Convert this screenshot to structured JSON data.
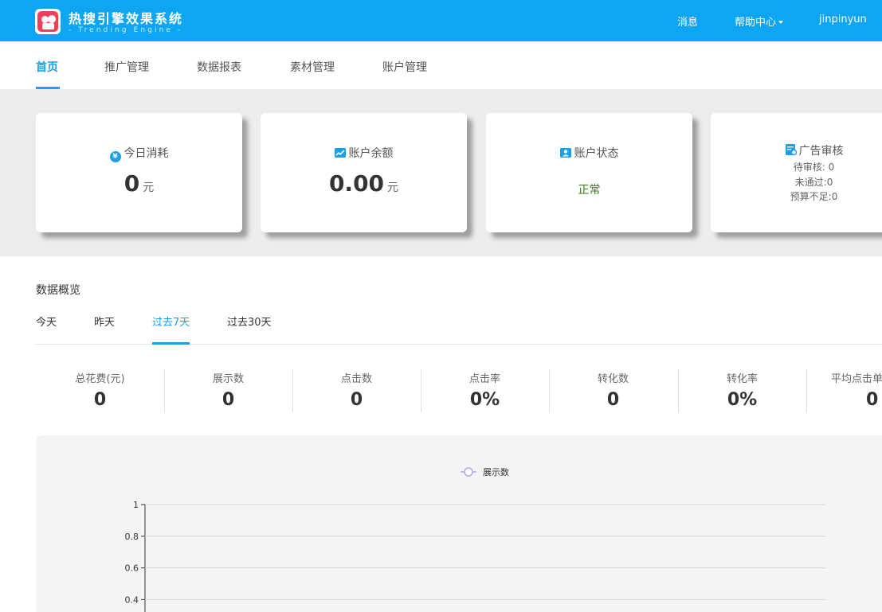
{
  "header": {
    "title": "热搜引擎效果系统",
    "subtitle": "- Trending Engine -",
    "nav": {
      "messages": "消息",
      "help": "帮助中心",
      "user": "jinpinyun"
    },
    "color": "#0ea5f2"
  },
  "topnav": {
    "items": [
      "首页",
      "推广管理",
      "数据报表",
      "素材管理",
      "账户管理"
    ],
    "active_index": 0
  },
  "cards": {
    "today_cost": {
      "title": "今日消耗",
      "value": "0",
      "unit": "元",
      "icon": "yen-icon"
    },
    "balance": {
      "title": "账户余额",
      "value": "0.00",
      "unit": "元",
      "icon": "trend-icon"
    },
    "status": {
      "title": "账户状态",
      "value": "正常",
      "icon": "user-card-icon",
      "value_color": "#2f7d12"
    },
    "review": {
      "title": "广告审核",
      "icon": "review-doc-icon",
      "pending": "待审核: 0",
      "rejected": "未通过:0",
      "budget": "预算不足:0"
    }
  },
  "overview": {
    "title": "数据概览",
    "tabs": [
      "今天",
      "昨天",
      "过去7天",
      "过去30天"
    ],
    "active_tab": 2,
    "metrics": [
      {
        "label": "总花费(元)",
        "value": "0"
      },
      {
        "label": "展示数",
        "value": "0"
      },
      {
        "label": "点击数",
        "value": "0"
      },
      {
        "label": "点击率",
        "value": "0%"
      },
      {
        "label": "转化数",
        "value": "0"
      },
      {
        "label": "转化率",
        "value": "0%"
      },
      {
        "label": "平均点击单",
        "value": "0"
      }
    ]
  },
  "chart_data": {
    "type": "line",
    "legend": [
      "展示数"
    ],
    "legend_placement": "top-center",
    "series": [
      {
        "name": "展示数",
        "values": [],
        "color": "#b8a4e6"
      }
    ],
    "yticks": [
      "1",
      "0.8",
      "0.6",
      "0.4"
    ],
    "ylim": [
      0,
      1
    ],
    "grid": true
  }
}
